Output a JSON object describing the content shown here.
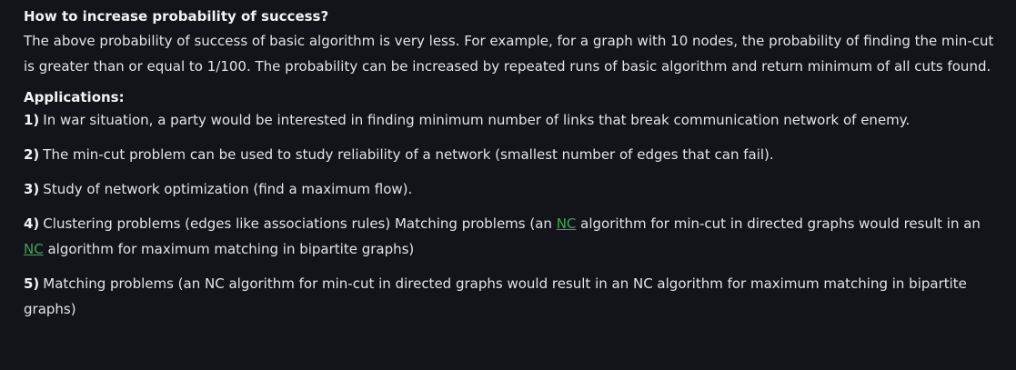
{
  "section": {
    "heading": "How to increase probability of success?",
    "paragraph": "The above probability of success of basic algorithm is very less. For example, for a graph with 10 nodes, the probability of finding the min-cut is greater than or equal to 1/100. The probability can be increased by repeated runs of basic algorithm and return minimum of all cuts found."
  },
  "applications": {
    "heading": "Applications:",
    "items": [
      {
        "num": "1)",
        "text": "In war situation, a party would be interested in finding minimum number of links that break communication network of enemy."
      },
      {
        "num": "2)",
        "text": "The min-cut problem can be used to study reliability of a network (smallest number of edges that can fail)."
      },
      {
        "num": "3)",
        "text": "Study of network optimization (find a maximum flow)."
      },
      {
        "num": "4)",
        "text_a": "Clustering problems (edges like associations rules) Matching problems (an ",
        "link_a": "NC",
        "text_b": " algorithm for min-cut in directed graphs would result in an ",
        "link_b": "NC",
        "text_c": " algorithm for maximum matching in bipartite graphs)"
      },
      {
        "num": "5)",
        "text": "Matching problems (an NC algorithm for min-cut in directed graphs would result in an NC algorithm for maximum matching in bipartite graphs)"
      }
    ]
  },
  "colors": {
    "background": "#131419",
    "text": "#e4e4e7",
    "link": "#3fa657"
  }
}
